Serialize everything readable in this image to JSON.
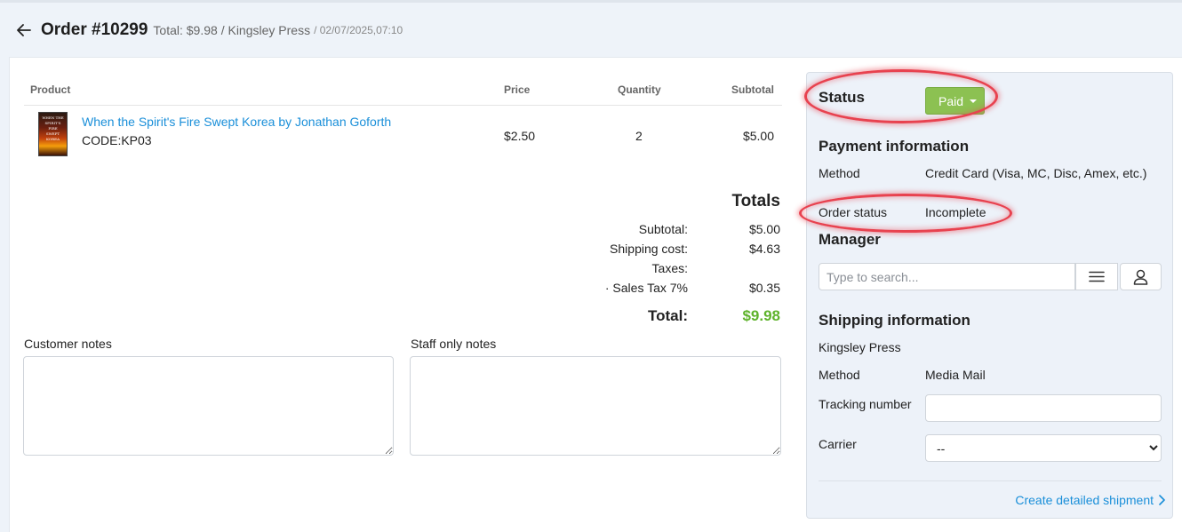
{
  "order": {
    "title": "Order #10299",
    "summary": "Total: $9.98 / Kingsley Press",
    "date": "/ 02/07/2025,07:10"
  },
  "table": {
    "headers": {
      "product": "Product",
      "price": "Price",
      "quantity": "Quantity",
      "subtotal": "Subtotal"
    },
    "rows": [
      {
        "name": "When the Spirit's Fire Swept Korea by Jonathan Goforth",
        "code": "CODE:KP03",
        "price": "$2.50",
        "quantity": "2",
        "subtotal": "$5.00",
        "cover_text": [
          "WHEN THE",
          "SPIRIT'S",
          "FIRE",
          "SWEPT",
          "KOREA"
        ]
      }
    ]
  },
  "totals": {
    "title": "Totals",
    "subtotal_label": "Subtotal:",
    "subtotal_value": "$5.00",
    "shipping_label": "Shipping cost:",
    "shipping_value": "$4.63",
    "taxes_label": "Taxes:",
    "sales_tax_label": "· Sales Tax 7%",
    "sales_tax_value": "$0.35",
    "total_label": "Total:",
    "total_value": "$9.98"
  },
  "notes": {
    "customer_label": "Customer notes",
    "staff_label": "Staff only notes"
  },
  "panel": {
    "status_title": "Status",
    "status_value": "Paid",
    "payment_title": "Payment information",
    "method_label": "Method",
    "method_value": "Credit Card (Visa, MC, Disc, Amex, etc.)",
    "order_status_label": "Order status",
    "order_status_value": "Incomplete",
    "manager_title": "Manager",
    "search_placeholder": "Type to search...",
    "shipping_title": "Shipping information",
    "shipping_company": "Kingsley Press",
    "ship_method_label": "Method",
    "ship_method_value": "Media Mail",
    "tracking_label": "Tracking number",
    "carrier_label": "Carrier",
    "carrier_value": "--",
    "create_shipment": "Create detailed shipment"
  },
  "colors": {
    "link": "#1a8fd9",
    "paid_button": "#8cc152",
    "total_green": "#5fb32c",
    "highlight_ring": "#e8424f"
  },
  "icons": [
    "arrow-left-icon",
    "menu-lines-icon",
    "user-icon",
    "chevron-right-icon",
    "caret-down-icon"
  ]
}
